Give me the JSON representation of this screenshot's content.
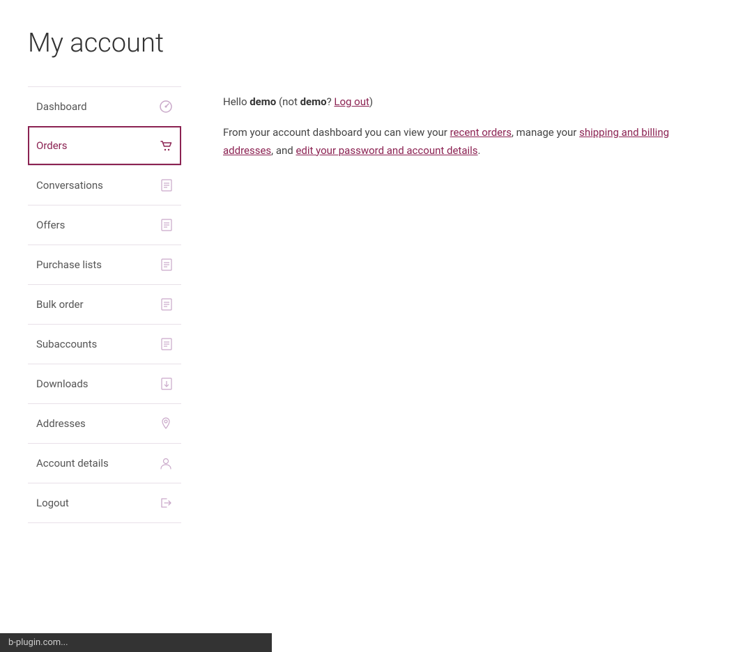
{
  "page": {
    "title": "My account"
  },
  "greeting": {
    "text_hello": "Hello",
    "username": "demo",
    "text_not": "(not",
    "username2": "demo",
    "text_question": "?",
    "logout_label": "Log out",
    "text_end": ")"
  },
  "description": {
    "text_prefix": "From your account dashboard you can view your",
    "recent_orders_label": "recent orders",
    "text_mid1": ", manage your",
    "shipping_label": "shipping and billing addresses",
    "text_mid2": ", and",
    "password_label": "edit your password and account details",
    "text_end": "."
  },
  "sidebar": {
    "items": [
      {
        "id": "dashboard",
        "label": "Dashboard",
        "icon": "gauge",
        "active": false
      },
      {
        "id": "orders",
        "label": "Orders",
        "icon": "basket",
        "active": true
      },
      {
        "id": "conversations",
        "label": "Conversations",
        "icon": "document",
        "active": false
      },
      {
        "id": "offers",
        "label": "Offers",
        "icon": "document",
        "active": false
      },
      {
        "id": "purchase-lists",
        "label": "Purchase lists",
        "icon": "document",
        "active": false
      },
      {
        "id": "bulk-order",
        "label": "Bulk order",
        "icon": "document",
        "active": false
      },
      {
        "id": "subaccounts",
        "label": "Subaccounts",
        "icon": "document",
        "active": false
      },
      {
        "id": "downloads",
        "label": "Downloads",
        "icon": "document-download",
        "active": false
      },
      {
        "id": "addresses",
        "label": "Addresses",
        "icon": "home",
        "active": false
      },
      {
        "id": "account-details",
        "label": "Account details",
        "icon": "user",
        "active": false
      },
      {
        "id": "logout",
        "label": "Logout",
        "icon": "logout",
        "active": false
      }
    ]
  },
  "status_bar": {
    "text": "b-plugin.com..."
  }
}
